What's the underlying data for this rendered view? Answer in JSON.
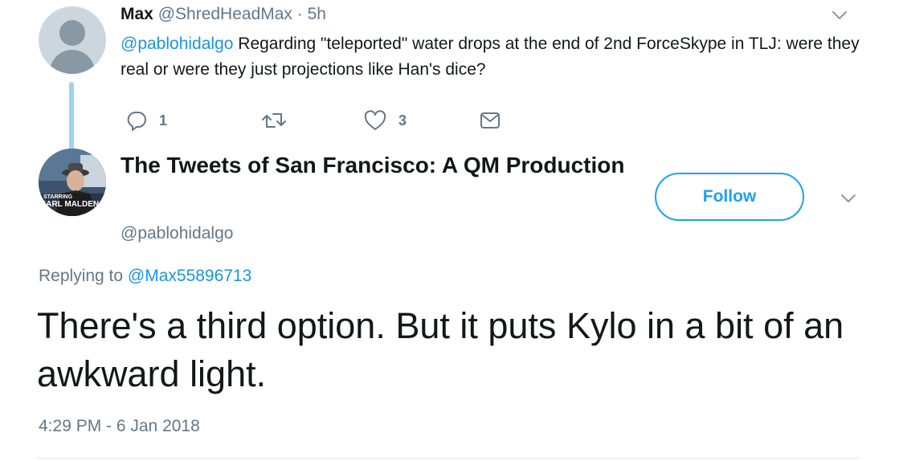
{
  "parent_tweet": {
    "name": "Max",
    "handle": "@ShredHeadMax",
    "separator": "·",
    "time": "5h",
    "mention": "@pablohidalgo",
    "text": " Regarding \"teleported\" water drops at the end of 2nd ForceSkype in TLJ: were they real or were they just projections like Han's dice?",
    "reply_count": "1",
    "retweet_count": "",
    "like_count": "3"
  },
  "focused_tweet": {
    "display_name": "The Tweets of San Francisco: A QM Production",
    "follow_label": "Follow",
    "username": "@pablohidalgo",
    "replying_prefix": "Replying to",
    "replying_to": "@Max55896713",
    "text": "There's a third option. But it puts Kylo in a bit of an awkward light.",
    "timestamp": "4:29 PM - 6 Jan 2018",
    "avatar_caption_top": "STARRING",
    "avatar_caption_bottom": "KARL MALDEN"
  },
  "colors": {
    "accent": "#1da1f2",
    "link": "#1b95e0",
    "muted": "#657786",
    "thread_line": "#9ed3f4"
  },
  "icons": {
    "reply": "speech-bubble-icon",
    "retweet": "retweet-arrows-icon",
    "like": "heart-icon",
    "dm": "envelope-icon",
    "more": "chevron-down-icon"
  }
}
